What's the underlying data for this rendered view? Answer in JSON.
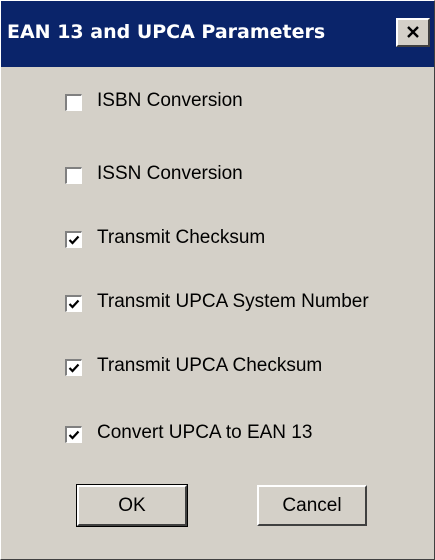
{
  "window": {
    "title": "EAN 13 and UPCA Parameters",
    "close_icon": "close-x-icon"
  },
  "options": [
    {
      "label": "ISBN Conversion",
      "checked": false
    },
    {
      "label": "ISSN Conversion",
      "checked": false
    },
    {
      "label": "Transmit Checksum",
      "checked": true
    },
    {
      "label": "Transmit UPCA System Number",
      "checked": true
    },
    {
      "label": "Transmit UPCA Checksum",
      "checked": true
    },
    {
      "label": "Convert UPCA to EAN 13",
      "checked": true
    }
  ],
  "buttons": {
    "ok": "OK",
    "cancel": "Cancel"
  },
  "colors": {
    "titlebar": "#0a246a",
    "face": "#d4d0c8"
  }
}
